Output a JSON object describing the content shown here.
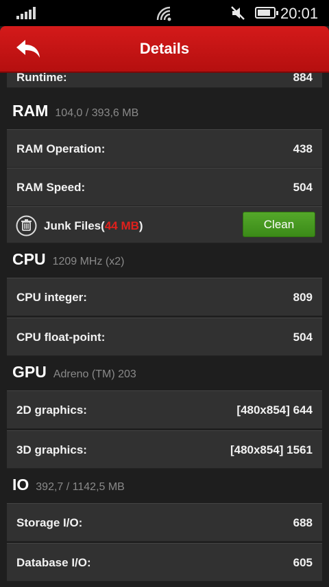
{
  "status_bar": {
    "time": "20:01"
  },
  "header": {
    "title": "Details"
  },
  "runtime": {
    "label": "Runtime:",
    "value": "884"
  },
  "sections": {
    "ram": {
      "title": "RAM",
      "subtitle": "104,0 / 393,6 MB",
      "rows": [
        {
          "label": "RAM Operation:",
          "value": "438"
        },
        {
          "label": "RAM Speed:",
          "value": "504"
        }
      ],
      "junk": {
        "label": "Junk Files",
        "open": "(",
        "size": "44 MB",
        "close": ")",
        "clean_label": "Clean"
      }
    },
    "cpu": {
      "title": "CPU",
      "subtitle": "1209 MHz (x2)",
      "rows": [
        {
          "label": "CPU integer:",
          "value": "809"
        },
        {
          "label": "CPU float-point:",
          "value": "504"
        }
      ]
    },
    "gpu": {
      "title": "GPU",
      "subtitle": "Adreno (TM) 203",
      "rows": [
        {
          "label": "2D graphics:",
          "value": "[480x854] 644"
        },
        {
          "label": "3D graphics:",
          "value": "[480x854] 1561"
        }
      ]
    },
    "io": {
      "title": "IO",
      "subtitle": "392,7 / 1142,5 MB",
      "rows": [
        {
          "label": "Storage I/O:",
          "value": "688"
        },
        {
          "label": "Database I/O:",
          "value": "605"
        }
      ]
    }
  },
  "colors": {
    "header": "#c41414",
    "clean_button": "#4a9a22",
    "junk_size": "#e0201c"
  }
}
